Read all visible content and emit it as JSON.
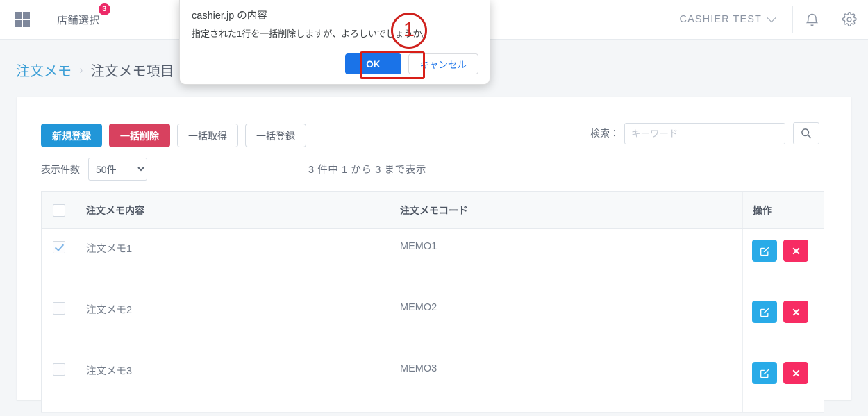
{
  "header": {
    "grid_icon": "grid-icon",
    "store_select_label": "店舗選択",
    "store_badge": "3",
    "account_name": "CASHIER TEST",
    "bell_icon": "bell-icon",
    "gear_icon": "gear-icon"
  },
  "breadcrumb": {
    "parent": "注文メモ",
    "separator": "›",
    "current": "注文メモ項目"
  },
  "toolbar": {
    "new_label": "新規登録",
    "bulk_delete_label": "一括削除",
    "bulk_fetch_label": "一括取得",
    "bulk_register_label": "一括登録"
  },
  "search": {
    "label": "検索：",
    "placeholder": "キーワード",
    "value": "",
    "submit_icon": "search-icon"
  },
  "listing": {
    "page_size_label": "表示件数",
    "page_size_value": "50件",
    "page_size_options": [
      "50件"
    ],
    "record_summary": "3 件中 1 から 3 まで表示"
  },
  "table": {
    "columns": [
      "",
      "注文メモ内容",
      "注文メモコード",
      "操作"
    ],
    "header_checkbox_checked": false,
    "rows": [
      {
        "checked": true,
        "memo": "注文メモ1",
        "code": "MEMO1",
        "edit_icon": "edit-icon",
        "delete_icon": "close-icon"
      },
      {
        "checked": false,
        "memo": "注文メモ2",
        "code": "MEMO2",
        "edit_icon": "edit-icon",
        "delete_icon": "close-icon"
      },
      {
        "checked": false,
        "memo": "注文メモ3",
        "code": "MEMO3",
        "edit_icon": "edit-icon",
        "delete_icon": "close-icon"
      }
    ]
  },
  "dialog": {
    "title": "cashier.jp の内容",
    "message": "指定された1行を一括削除しますが、よろしいでしょうか。",
    "ok_label": "OK",
    "cancel_label": "キャンセル"
  },
  "annotation": {
    "step_number": "1"
  },
  "colors": {
    "primary_blue": "#2196d8",
    "danger_red": "#d8415f",
    "action_blue": "#29abe8",
    "action_pink": "#f72c63",
    "badge_pink": "#ec2a68",
    "dialog_blue": "#1a73e8",
    "annotation_red": "#cf211d",
    "breadcrumb_link": "#3d9fd6",
    "page_bg": "#f4f6f8"
  }
}
